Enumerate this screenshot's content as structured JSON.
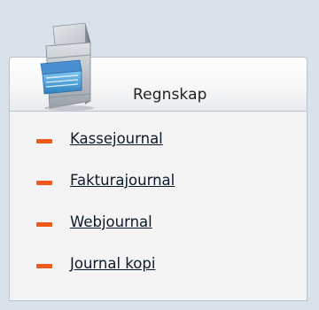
{
  "panel": {
    "title": "Regnskap",
    "icon": "file-cabinet-icon",
    "accent_color": "#ee5a1a",
    "items": [
      {
        "label": "Kassejournal"
      },
      {
        "label": "Fakturajournal"
      },
      {
        "label": "Webjournal"
      },
      {
        "label": "Journal kopi"
      }
    ]
  }
}
